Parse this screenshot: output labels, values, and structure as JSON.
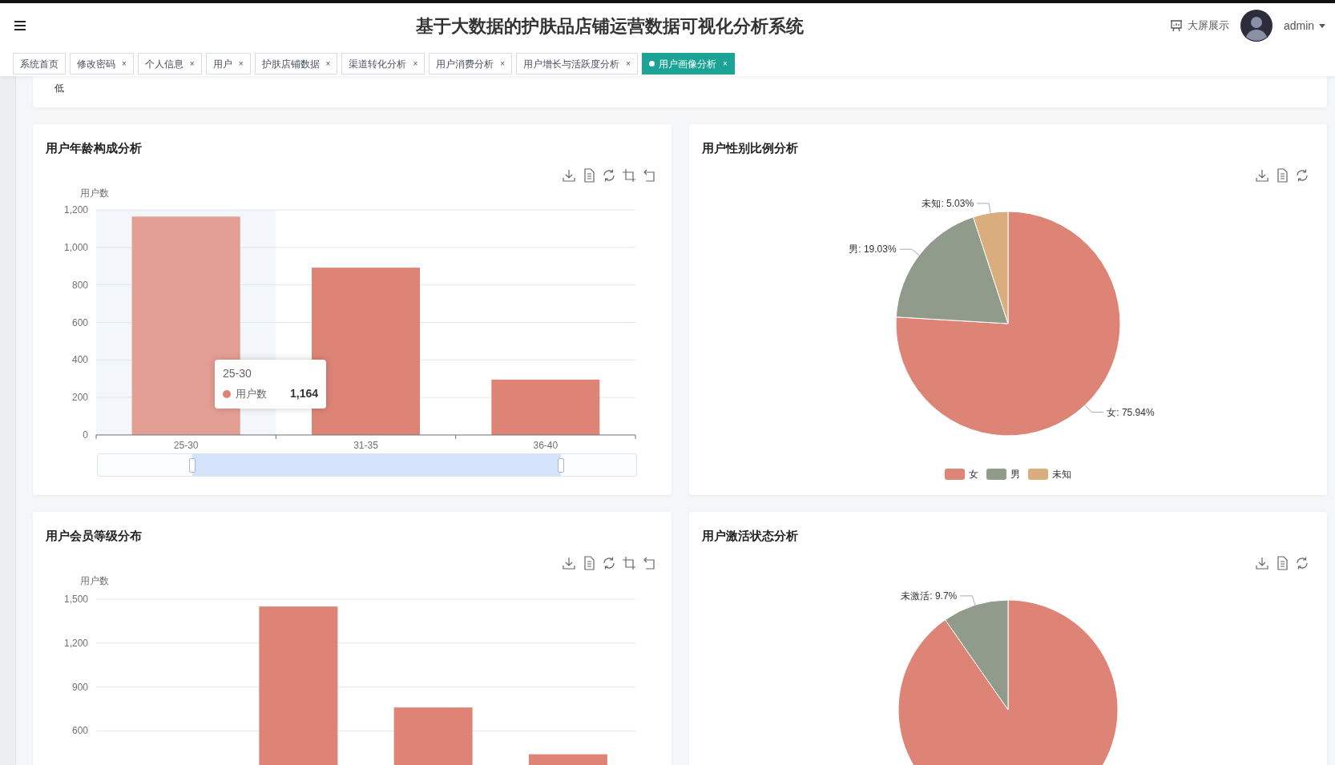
{
  "header": {
    "title": "基于大数据的护肤品店铺运营数据可视化分析系统",
    "screen_link": "大屏展示",
    "user": "admin"
  },
  "tabs": [
    {
      "label": "系统首页",
      "selected": false
    },
    {
      "label": "修改密码",
      "selected": false,
      "close": "×"
    },
    {
      "label": "个人信息",
      "selected": false,
      "close": "×"
    },
    {
      "label": "用户",
      "selected": false,
      "close": "×"
    },
    {
      "label": "护肤店铺数据",
      "selected": false,
      "close": "×"
    },
    {
      "label": "渠道转化分析",
      "selected": false,
      "close": "×"
    },
    {
      "label": "用户消费分析",
      "selected": false,
      "close": "×"
    },
    {
      "label": "用户增长与活跃度分析",
      "selected": false,
      "close": "×"
    },
    {
      "label": "用户画像分析",
      "selected": true,
      "close": "×"
    }
  ],
  "top_card": {
    "text": "低"
  },
  "cards": [
    {
      "title": "用户年龄构成分析",
      "hover": [
        true,
        false,
        false
      ],
      "tooltip": {
        "title": "25-30",
        "value": "1,164"
      },
      "zoom_slider": {
        "level": 0.86
      },
      "chart_data": {
        "type": "bar",
        "ylabel": "用户数",
        "categories": [
          "25-30",
          "31-35",
          "36-40"
        ],
        "series": [
          {
            "name": "用户数",
            "color": "#dd8477",
            "values": [
              1164,
              892,
              295
            ]
          }
        ],
        "ylim": [
          0,
          1200
        ],
        "grid": true,
        "yticks": [
          0,
          200,
          400,
          600,
          800,
          {
            "value": 1000,
            "label": "1,000"
          },
          {
            "value": 1200,
            "label": "1,200"
          }
        ]
      }
    },
    {
      "title": "用户性别比例分析",
      "chart_data": {
        "type": "pie",
        "categories": [
          "女",
          "男",
          "未知"
        ],
        "values": [
          75.94,
          19.03,
          5.03
        ],
        "colors": [
          "#dd8477",
          "#919b8b",
          "#d9ad7c"
        ],
        "value_labels": [
          "女: 75.94%",
          "男: 19.03%",
          "未知: 5.03%"
        ],
        "legend": true
      }
    },
    {
      "title": "用户会员等级分布",
      "chart_data": {
        "type": "bar",
        "ylabel": "用户数",
        "series": [
          {
            "color": "#dd8477",
            "values": [
              null,
              1450,
              760,
              440
            ]
          }
        ],
        "ylim": [
          0,
          1500
        ],
        "grid": true,
        "yticks": [
          600,
          900,
          {
            "value": 1200,
            "label": "1,200"
          },
          {
            "value": 1500,
            "label": "1,500"
          }
        ]
      }
    },
    {
      "title": "用户激活状态分析",
      "chart_data": {
        "type": "pie",
        "values": [
          90.3,
          9.7
        ],
        "colors": [
          "#dd8477",
          "#919b8b"
        ],
        "value_labels": [
          null,
          "未激活: 9.7%"
        ]
      }
    }
  ]
}
